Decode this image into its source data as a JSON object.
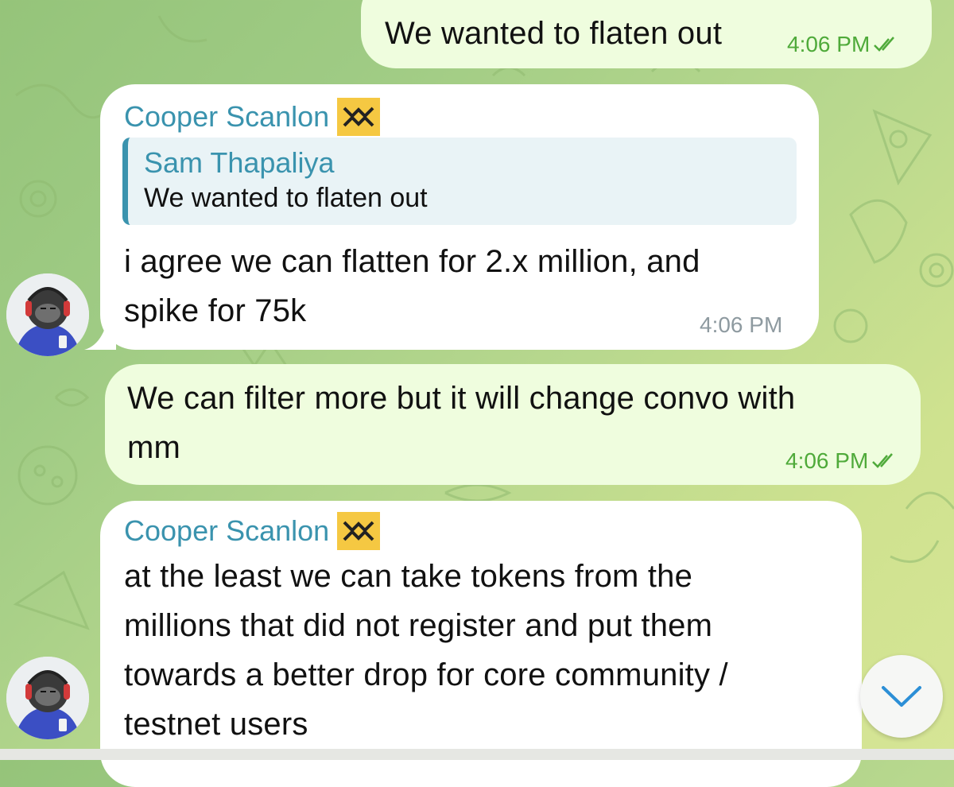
{
  "chat": {
    "messages": [
      {
        "direction": "outgoing",
        "text": "We wanted to flaten out",
        "time": "4:06 PM",
        "status_icon": "double-check-icon"
      },
      {
        "direction": "incoming",
        "sender": "Cooper Scanlon",
        "sender_badge": "yellow-logo-badge",
        "reply": {
          "name": "Sam Thapaliya",
          "text": "We wanted to flaten out"
        },
        "text_lines": [
          "i agree we can flatten for 2.x million, and",
          "spike for 75k"
        ],
        "time": "4:06 PM"
      },
      {
        "direction": "outgoing",
        "text_lines": [
          "We can filter more but it will change convo with",
          "mm"
        ],
        "time": "4:06 PM",
        "status_icon": "double-check-icon"
      },
      {
        "direction": "incoming",
        "sender": "Cooper Scanlon",
        "sender_badge": "yellow-logo-badge",
        "text_lines": [
          "at the least we can take tokens from the",
          "millions that did not register and put them",
          "towards a better drop for core community /",
          "testnet users"
        ]
      }
    ]
  },
  "colors": {
    "outgoing_bubble": "#effdde",
    "incoming_bubble": "#ffffff",
    "sender_name": "#3a93ae",
    "read_tick": "#4faa3a",
    "badge": "#f5c842"
  },
  "scroll_button": {
    "icon": "chevron-down-icon"
  }
}
